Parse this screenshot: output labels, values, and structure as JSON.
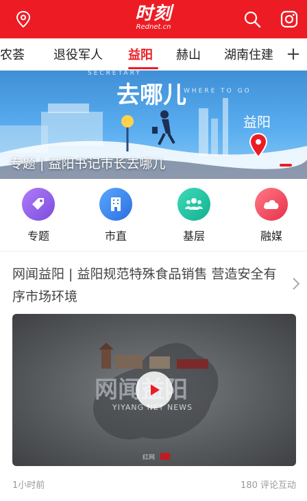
{
  "header": {
    "logo_text": "时刻",
    "logo_sub": "Rednet.cn",
    "icons": [
      "location-pin-icon",
      "search-icon",
      "instagram-camera-icon"
    ]
  },
  "tabs": [
    {
      "label": "湘农荟"
    },
    {
      "label": "退役军人"
    },
    {
      "label": "益阳"
    },
    {
      "label": "赫山"
    },
    {
      "label": "湖南住建"
    }
  ],
  "active_tab": "益阳",
  "tab_more": "+",
  "banner": {
    "caption": "专题 | 益阳书记市长去哪儿",
    "art_title": "去哪儿",
    "art_en_left": "SECRETARY",
    "art_en_right": "WHERE TO GO",
    "art_place": "益阳"
  },
  "shortcuts": [
    {
      "label": "专题",
      "icon": "tag-icon",
      "color": "#8e5be0"
    },
    {
      "label": "市直",
      "icon": "building-icon",
      "color": "#2f7fe8"
    },
    {
      "label": "基层",
      "icon": "people-icon",
      "color": "#19c1a1"
    },
    {
      "label": "融媒",
      "icon": "cloud-icon",
      "color": "#f0475a"
    }
  ],
  "article": {
    "title": "网闻益阳 | 益阳规范特殊食品销售 营造安全有序市场环境",
    "video_title": "网闻益阳",
    "video_sub": "YIYANG NET NEWS",
    "watermark": "红网",
    "time": "1小时前",
    "comments": "180 评论互动"
  },
  "colors": {
    "brand": "#ed1c24"
  }
}
